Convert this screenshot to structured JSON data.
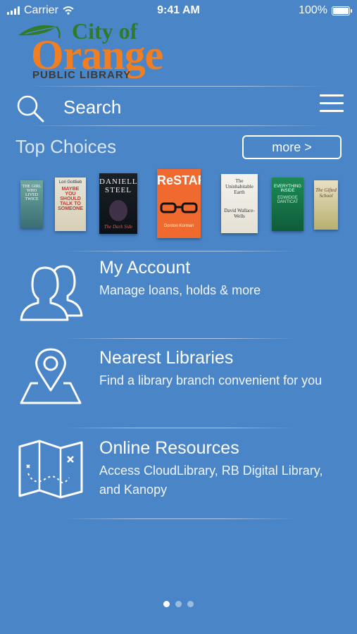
{
  "status_bar": {
    "carrier": "Carrier",
    "time": "9:41 AM",
    "battery": "100%"
  },
  "logo": {
    "city": "City of",
    "name": "Orange",
    "subtitle": "PUBLIC LIBRARY"
  },
  "search": {
    "placeholder": "Search"
  },
  "top_choices": {
    "heading": "Top Choices",
    "more_label": "more >",
    "books": [
      {
        "cover_text": "THE GIRL WHO LIVED TWICE"
      },
      {
        "cover_text": "MAYBE YOU SHOULD TALK TO SOMEONE",
        "author": "Lori Gottlieb"
      },
      {
        "cover_text": "DANIELLE STEEL",
        "subtitle": "The Dark Side"
      },
      {
        "cover_text": "ReSTART",
        "author": "Gordon Korman"
      },
      {
        "cover_text": "The Uninhabitable Earth",
        "author": "David Wallace-Wells"
      },
      {
        "cover_text": "EVERYTHING INSIDE",
        "author": "EDWIDGE DANTICAT"
      },
      {
        "cover_text": "The Gifted School"
      }
    ]
  },
  "menu": [
    {
      "title": "My Account",
      "desc": "Manage loans, holds & more",
      "icon": "people-icon"
    },
    {
      "title": "Nearest Libraries",
      "desc": "Find a library branch convenient for you",
      "icon": "map-pin-icon"
    },
    {
      "title": "Online Resources",
      "desc": "Access CloudLibrary, RB Digital Library, and Kanopy",
      "icon": "treasure-map-icon"
    }
  ],
  "pager": {
    "count": 3,
    "active": 1
  },
  "colors": {
    "background": "#4a85c8",
    "logo_green": "#2f7b2a",
    "logo_orange": "#f07e22"
  }
}
